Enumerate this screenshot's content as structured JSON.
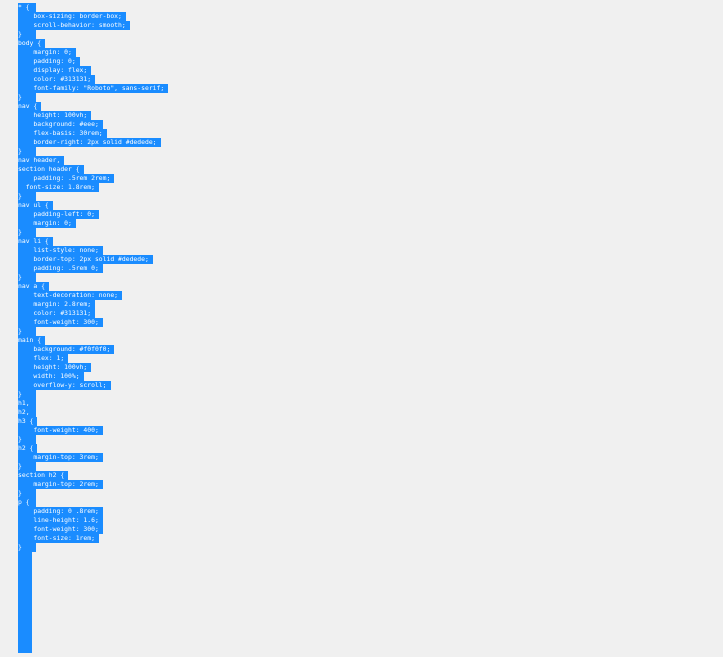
{
  "editor": {
    "selection_color": "#1a8cff",
    "background_color": "#f0f0f0",
    "lines": [
      "* {",
      "    box-sizing: border-box;",
      "    scroll-behavior: smooth;",
      "}",
      "body {",
      "    margin: 0;",
      "    padding: 0;",
      "    display: flex;",
      "    color: #313131;",
      "    font-family: \"Roboto\", sans-serif;",
      "}",
      "nav {",
      "    height: 100vh;",
      "    background: #eee;",
      "    flex-basis: 30rem;",
      "    border-right: 2px solid #dedede;",
      "}",
      "nav header,",
      "section header {",
      "    padding: .5rem 2rem;",
      "  font-size: 1.8rem;",
      "}",
      "nav ul {",
      "    padding-left: 0;",
      "    margin: 0;",
      "}",
      "nav li {",
      "    list-style: none;",
      "    border-top: 2px solid #dedede;",
      "    padding: .5rem 0;",
      "}",
      "nav a {",
      "    text-decoration: none;",
      "    margin: 2.8rem;",
      "    color: #313131;",
      "    font-weight: 300;",
      "}",
      "main {",
      "    background: #f0f0f0;",
      "    flex: 1;",
      "    height: 100vh;",
      "    width: 100%;",
      "    overflow-y: scroll;",
      "}",
      "h1,",
      "h2,",
      "h3 {",
      "    font-weight: 400;",
      "}",
      "h2 {",
      "    margin-top: 3rem;",
      "}",
      "section h2 {",
      "    margin-top: 2rem;",
      "}",
      "p {",
      "    padding: 0 .8rem;",
      "    line-height: 1.6;",
      "    font-weight: 300;",
      "    font-size: 1rem;",
      "}"
    ]
  }
}
